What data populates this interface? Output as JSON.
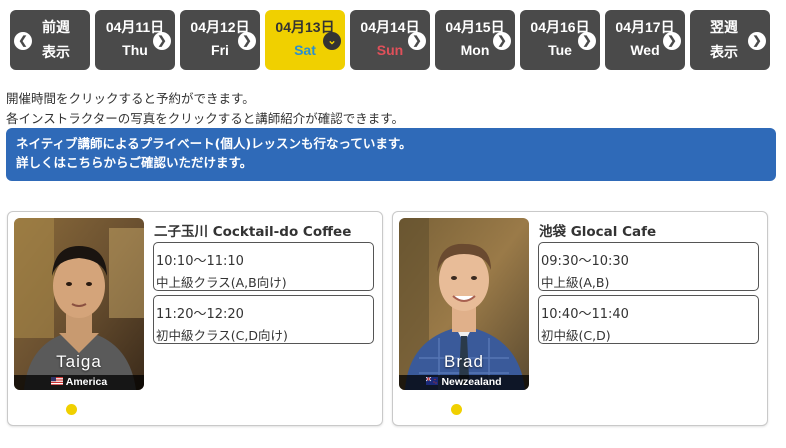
{
  "date_nav": {
    "prev": {
      "line1": "前週",
      "line2": "表示"
    },
    "days": [
      {
        "date": "04月11日",
        "weekday": "Thu"
      },
      {
        "date": "04月12日",
        "weekday": "Fri"
      },
      {
        "date": "04月13日",
        "weekday": "Sat",
        "active": true
      },
      {
        "date": "04月14日",
        "weekday": "Sun"
      },
      {
        "date": "04月15日",
        "weekday": "Mon"
      },
      {
        "date": "04月16日",
        "weekday": "Tue"
      },
      {
        "date": "04月17日",
        "weekday": "Wed"
      }
    ],
    "next": {
      "line1": "翌週",
      "line2": "表示"
    }
  },
  "info": {
    "line1": "開催時間をクリックすると予約ができます。",
    "line2": "各インストラクターの写真をクリックすると講師紹介が確認できます。"
  },
  "banner": {
    "line1": "ネイティブ講師によるプライベート(個人)レッスンも行なっています。",
    "line2": "詳しくはこちらからご確認いただけます。"
  },
  "colors": {
    "tab_bg": "#4a4a4a",
    "active_tab": "#f0d000",
    "saturday": "#2a8fd0",
    "sunday": "#e0505a",
    "banner": "#2f6ab8"
  },
  "instructors": [
    {
      "name": "Taiga",
      "country": "America",
      "flag_icon": "us-flag-icon",
      "venue": "二子玉川 Cocktail-do Coffee",
      "slots": [
        {
          "time": "10:10〜11:10",
          "level": "中上級クラス(A,B向け)"
        },
        {
          "time": "11:20〜12:20",
          "level": "初中級クラス(C,D向け)"
        }
      ]
    },
    {
      "name": "Brad",
      "country": "Newzealand",
      "flag_icon": "nz-flag-icon",
      "venue": "池袋 Glocal Cafe",
      "slots": [
        {
          "time": "09:30〜10:30",
          "level": "中上級(A,B)"
        },
        {
          "time": "10:40〜11:40",
          "level": "初中級(C,D)"
        }
      ]
    }
  ]
}
